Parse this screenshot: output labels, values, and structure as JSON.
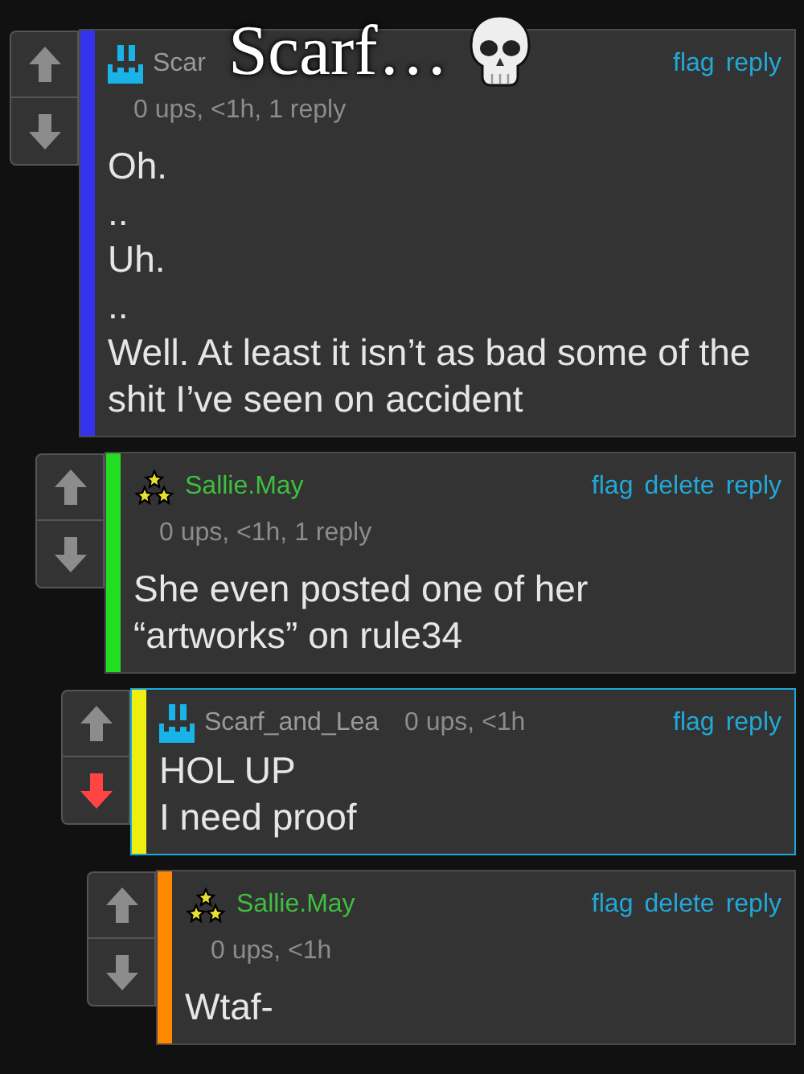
{
  "caption": {
    "text": "Scarf…"
  },
  "comments": [
    {
      "kind": "castle",
      "username": "Scar",
      "own_comment": false,
      "meta_inline": false,
      "meta": "0 ups, <1h, 1 reply",
      "actions": [
        "flag",
        "reply"
      ],
      "color": "#3333ee",
      "downvoted": false,
      "highlighted": false,
      "lines": [
        "Oh.",
        "..",
        "Uh.",
        "..",
        "Well. At least it isn’t as bad some of the shit I’ve seen on accident"
      ]
    },
    {
      "kind": "stars",
      "username": "Sallie.May",
      "own_comment": true,
      "meta_inline": false,
      "meta": "0 ups, <1h, 1 reply",
      "actions": [
        "flag",
        "delete",
        "reply"
      ],
      "color": "#22dd22",
      "downvoted": false,
      "highlighted": false,
      "lines": [
        "She even posted one of her",
        "“artworks” on rule34"
      ]
    },
    {
      "kind": "castle",
      "username": "Scarf_and_Lea",
      "own_comment": false,
      "meta_inline": true,
      "meta": "0 ups, <1h",
      "actions": [
        "flag",
        "reply"
      ],
      "color": "#eeee11",
      "downvoted": true,
      "highlighted": true,
      "lines": [
        "HOL UP",
        "I need proof"
      ]
    },
    {
      "kind": "stars",
      "username": "Sallie.May",
      "own_comment": true,
      "meta_inline": false,
      "meta": "0 ups, <1h",
      "actions": [
        "flag",
        "delete",
        "reply"
      ],
      "color": "#ff8800",
      "downvoted": false,
      "highlighted": false,
      "lines": [
        "Wtaf-"
      ]
    }
  ]
}
